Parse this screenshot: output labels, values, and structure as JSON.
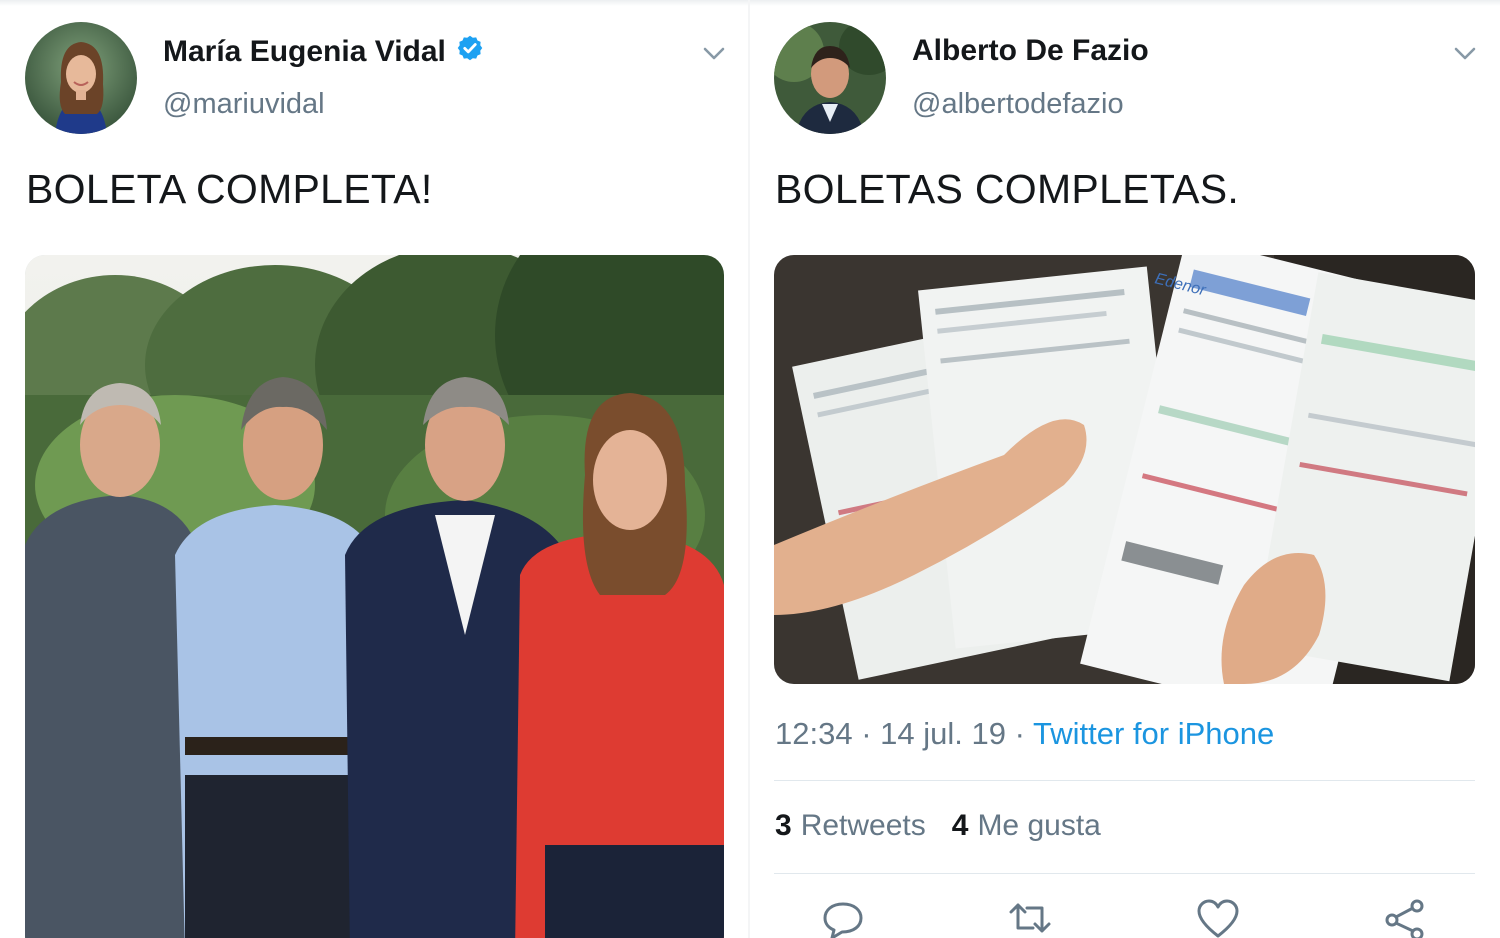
{
  "tweets": [
    {
      "display_name": "María Eugenia Vidal",
      "verified": true,
      "handle": "@mariuvidal",
      "text": "BOLETA COMPLETA!",
      "avatar_icon": "profile-photo",
      "menu_icon": "chevron-down-icon",
      "media": "photo-four-people-outdoors"
    },
    {
      "display_name": "Alberto De Fazio",
      "verified": false,
      "handle": "@albertodefazio",
      "text": "BOLETAS COMPLETAS.",
      "avatar_icon": "profile-photo",
      "menu_icon": "chevron-down-icon",
      "media": "photo-hands-holding-bills",
      "media_brand_text": "Edenor",
      "time": "12:34",
      "date": "14 jul. 19",
      "separator": "·",
      "source": "Twitter for iPhone",
      "retweets_count": "3",
      "retweets_label": "Retweets",
      "likes_count": "4",
      "likes_label": "Me gusta",
      "actions": [
        "reply-icon",
        "retweet-icon",
        "like-icon",
        "share-icon"
      ]
    }
  ],
  "colors": {
    "text": "#14171a",
    "secondary": "#657786",
    "link": "#1b95e0",
    "verified": "#1da1f2",
    "divider": "#e1e8ed"
  }
}
